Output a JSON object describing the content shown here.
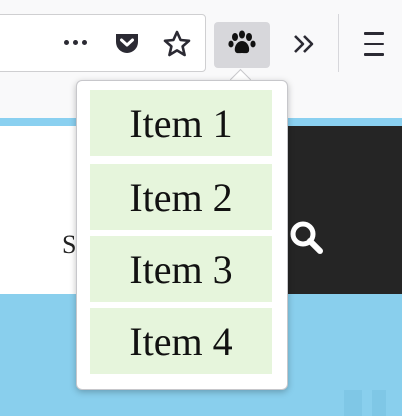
{
  "toolbar": {
    "page_actions_icon": "more-dots-icon",
    "pocket_icon": "pocket-icon",
    "bookmark_icon": "star-icon",
    "extension_icon": "paw-icon",
    "overflow_icon": "double-chevron-right-icon",
    "menu_icon": "hamburger-menu-icon",
    "overflow_glyph": "»"
  },
  "page": {
    "partial_text": "S",
    "search_icon": "search-icon",
    "colors": {
      "header_dark": "#252525",
      "hero": "#89cfed",
      "stripe": "#8ad0f0"
    }
  },
  "popup": {
    "item_background": "#e6f5dc",
    "items": [
      {
        "label": "Item 1"
      },
      {
        "label": "Item 2"
      },
      {
        "label": "Item 3"
      },
      {
        "label": "Item 4"
      }
    ]
  }
}
